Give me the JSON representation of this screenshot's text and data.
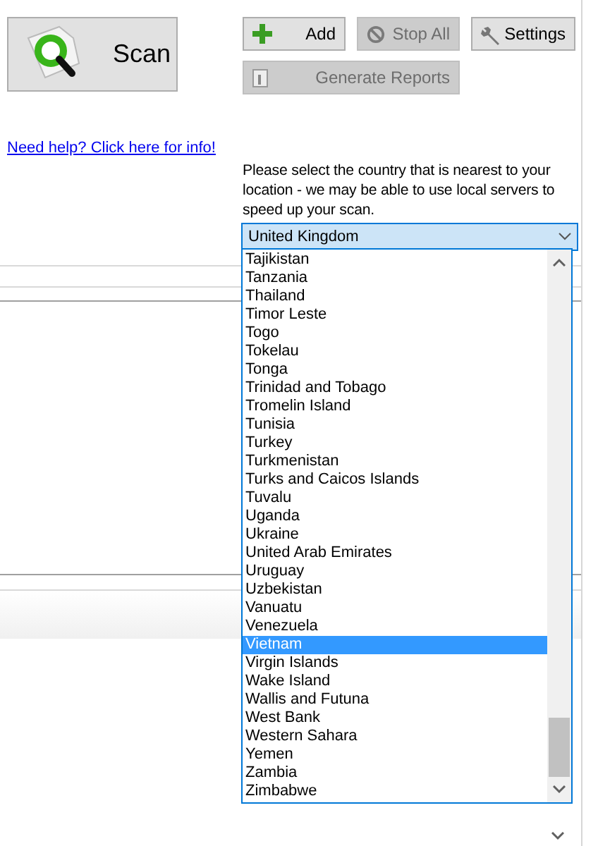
{
  "toolbar": {
    "scan_button": {
      "label": "Scan"
    },
    "buttons": [
      {
        "label": "Add",
        "kind": "add",
        "disabled": false
      },
      {
        "label": "Stop All",
        "kind": "stop",
        "disabled": true
      },
      {
        "label": "Settings",
        "kind": "settings",
        "disabled": false
      },
      {
        "label": "Generate Reports",
        "kind": "report",
        "disabled": true
      }
    ]
  },
  "help_link": "Need help? Click here for info!",
  "country_prompt": "Please select the country that is nearest to your location - we may be able to use local servers to speed up your scan.",
  "country_select": {
    "value": "United Kingdom",
    "options": [
      {
        "label": "Tajikistan",
        "selected": false
      },
      {
        "label": "Tanzania",
        "selected": false
      },
      {
        "label": "Thailand",
        "selected": false
      },
      {
        "label": "Timor Leste",
        "selected": false
      },
      {
        "label": "Togo",
        "selected": false
      },
      {
        "label": "Tokelau",
        "selected": false
      },
      {
        "label": "Tonga",
        "selected": false
      },
      {
        "label": "Trinidad and Tobago",
        "selected": false
      },
      {
        "label": "Tromelin Island",
        "selected": false
      },
      {
        "label": "Tunisia",
        "selected": false
      },
      {
        "label": "Turkey",
        "selected": false
      },
      {
        "label": "Turkmenistan",
        "selected": false
      },
      {
        "label": "Turks and Caicos Islands",
        "selected": false
      },
      {
        "label": "Tuvalu",
        "selected": false
      },
      {
        "label": "Uganda",
        "selected": false
      },
      {
        "label": "Ukraine",
        "selected": false
      },
      {
        "label": "United Arab Emirates",
        "selected": false
      },
      {
        "label": "Uruguay",
        "selected": false
      },
      {
        "label": "Uzbekistan",
        "selected": false
      },
      {
        "label": "Vanuatu",
        "selected": false
      },
      {
        "label": "Venezuela",
        "selected": false
      },
      {
        "label": "Vietnam",
        "selected": true
      },
      {
        "label": "Virgin Islands",
        "selected": false
      },
      {
        "label": "Wake Island",
        "selected": false
      },
      {
        "label": "Wallis and Futuna",
        "selected": false
      },
      {
        "label": "West Bank",
        "selected": false
      },
      {
        "label": "Western Sahara",
        "selected": false
      },
      {
        "label": "Yemen",
        "selected": false
      },
      {
        "label": "Zambia",
        "selected": false
      },
      {
        "label": "Zimbabwe",
        "selected": false
      }
    ]
  }
}
